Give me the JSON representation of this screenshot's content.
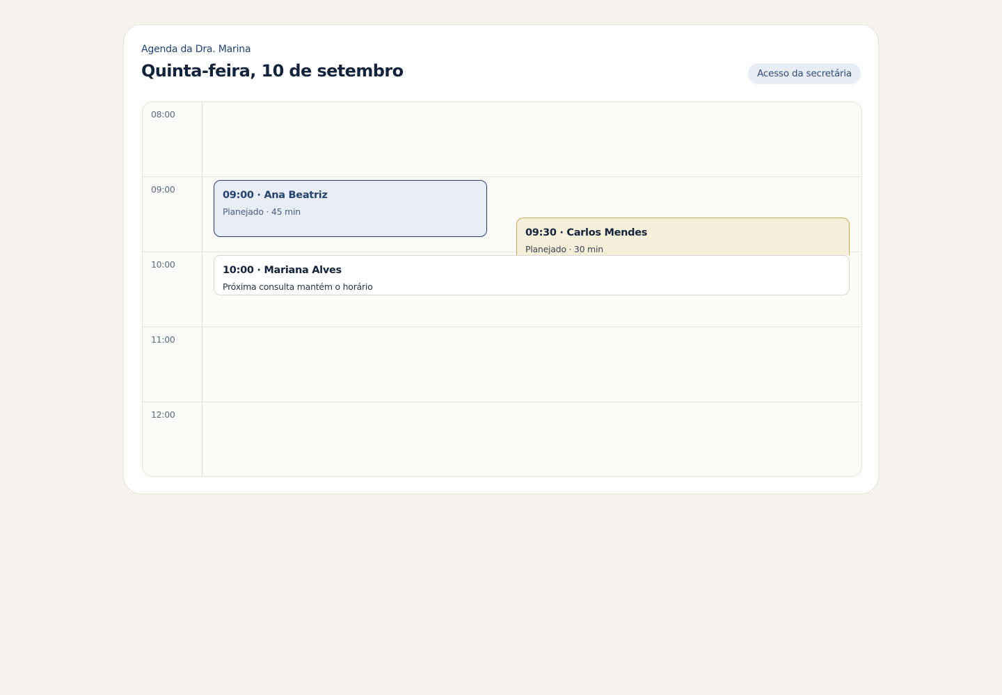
{
  "header": {
    "subtitle": "Agenda da Dra. Marina",
    "title": "Quinta-feira, 10 de setembro",
    "access_badge": "Acesso da secretária"
  },
  "hours": [
    "08:00",
    "09:00",
    "10:00",
    "11:00",
    "12:00"
  ],
  "appointments": [
    {
      "title": "09:00 · Ana Beatriz",
      "subtitle": "Planejado · 45 min"
    },
    {
      "title": "09:30 · Carlos Mendes",
      "subtitle": "Planejado · 30 min"
    },
    {
      "title": "10:00 · Mariana Alves",
      "subtitle": "Próxima consulta mantém o horário"
    }
  ],
  "colors": {
    "background": "#f3f2ed",
    "card": "#ffffff",
    "accent_blue": "#1e3f6e",
    "planned_blue_fill": "#e8edf6",
    "planned_yellow_fill": "#f6f0da",
    "planned_yellow_border": "#c8aa4e"
  }
}
